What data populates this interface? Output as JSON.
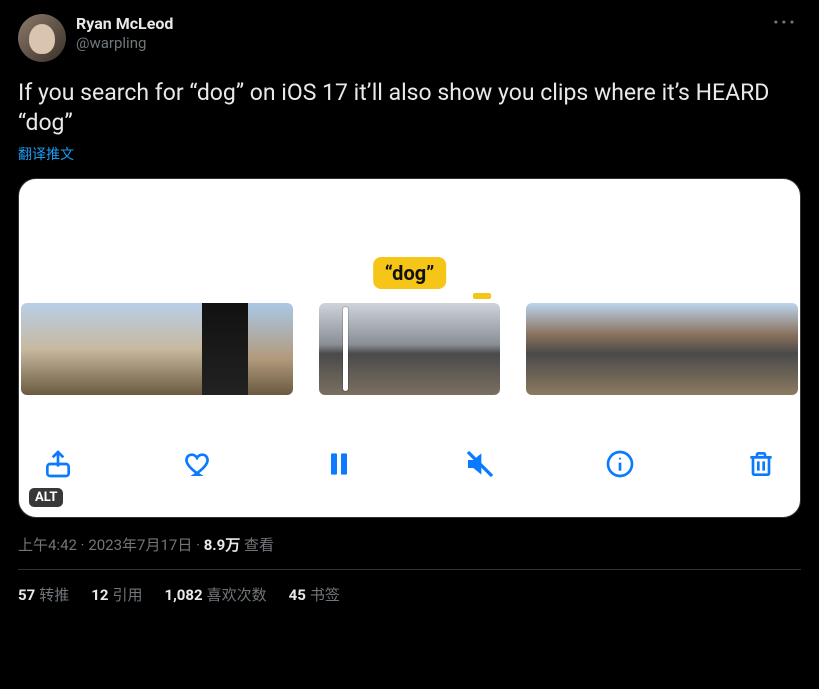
{
  "author": {
    "display_name": "Ryan McLeod",
    "handle": "@warpling"
  },
  "tweet_text": "If you search for “dog” on iOS 17 it’ll also show you clips where it’s HEARD “dog”",
  "translate_label": "翻译推文",
  "media": {
    "caption_bubble": "“dog”",
    "alt_badge": "ALT"
  },
  "meta": {
    "time": "上午4:42",
    "dot1": " · ",
    "date": "2023年7月17日",
    "dot2": " · ",
    "views_count": "8.9万",
    "views_label": " 查看"
  },
  "stats": {
    "retweets": {
      "count": "57",
      "label": "转推"
    },
    "quotes": {
      "count": "12",
      "label": "引用"
    },
    "likes": {
      "count": "1,082",
      "label": "喜欢次数"
    },
    "bookmarks": {
      "count": "45",
      "label": "书签"
    }
  }
}
